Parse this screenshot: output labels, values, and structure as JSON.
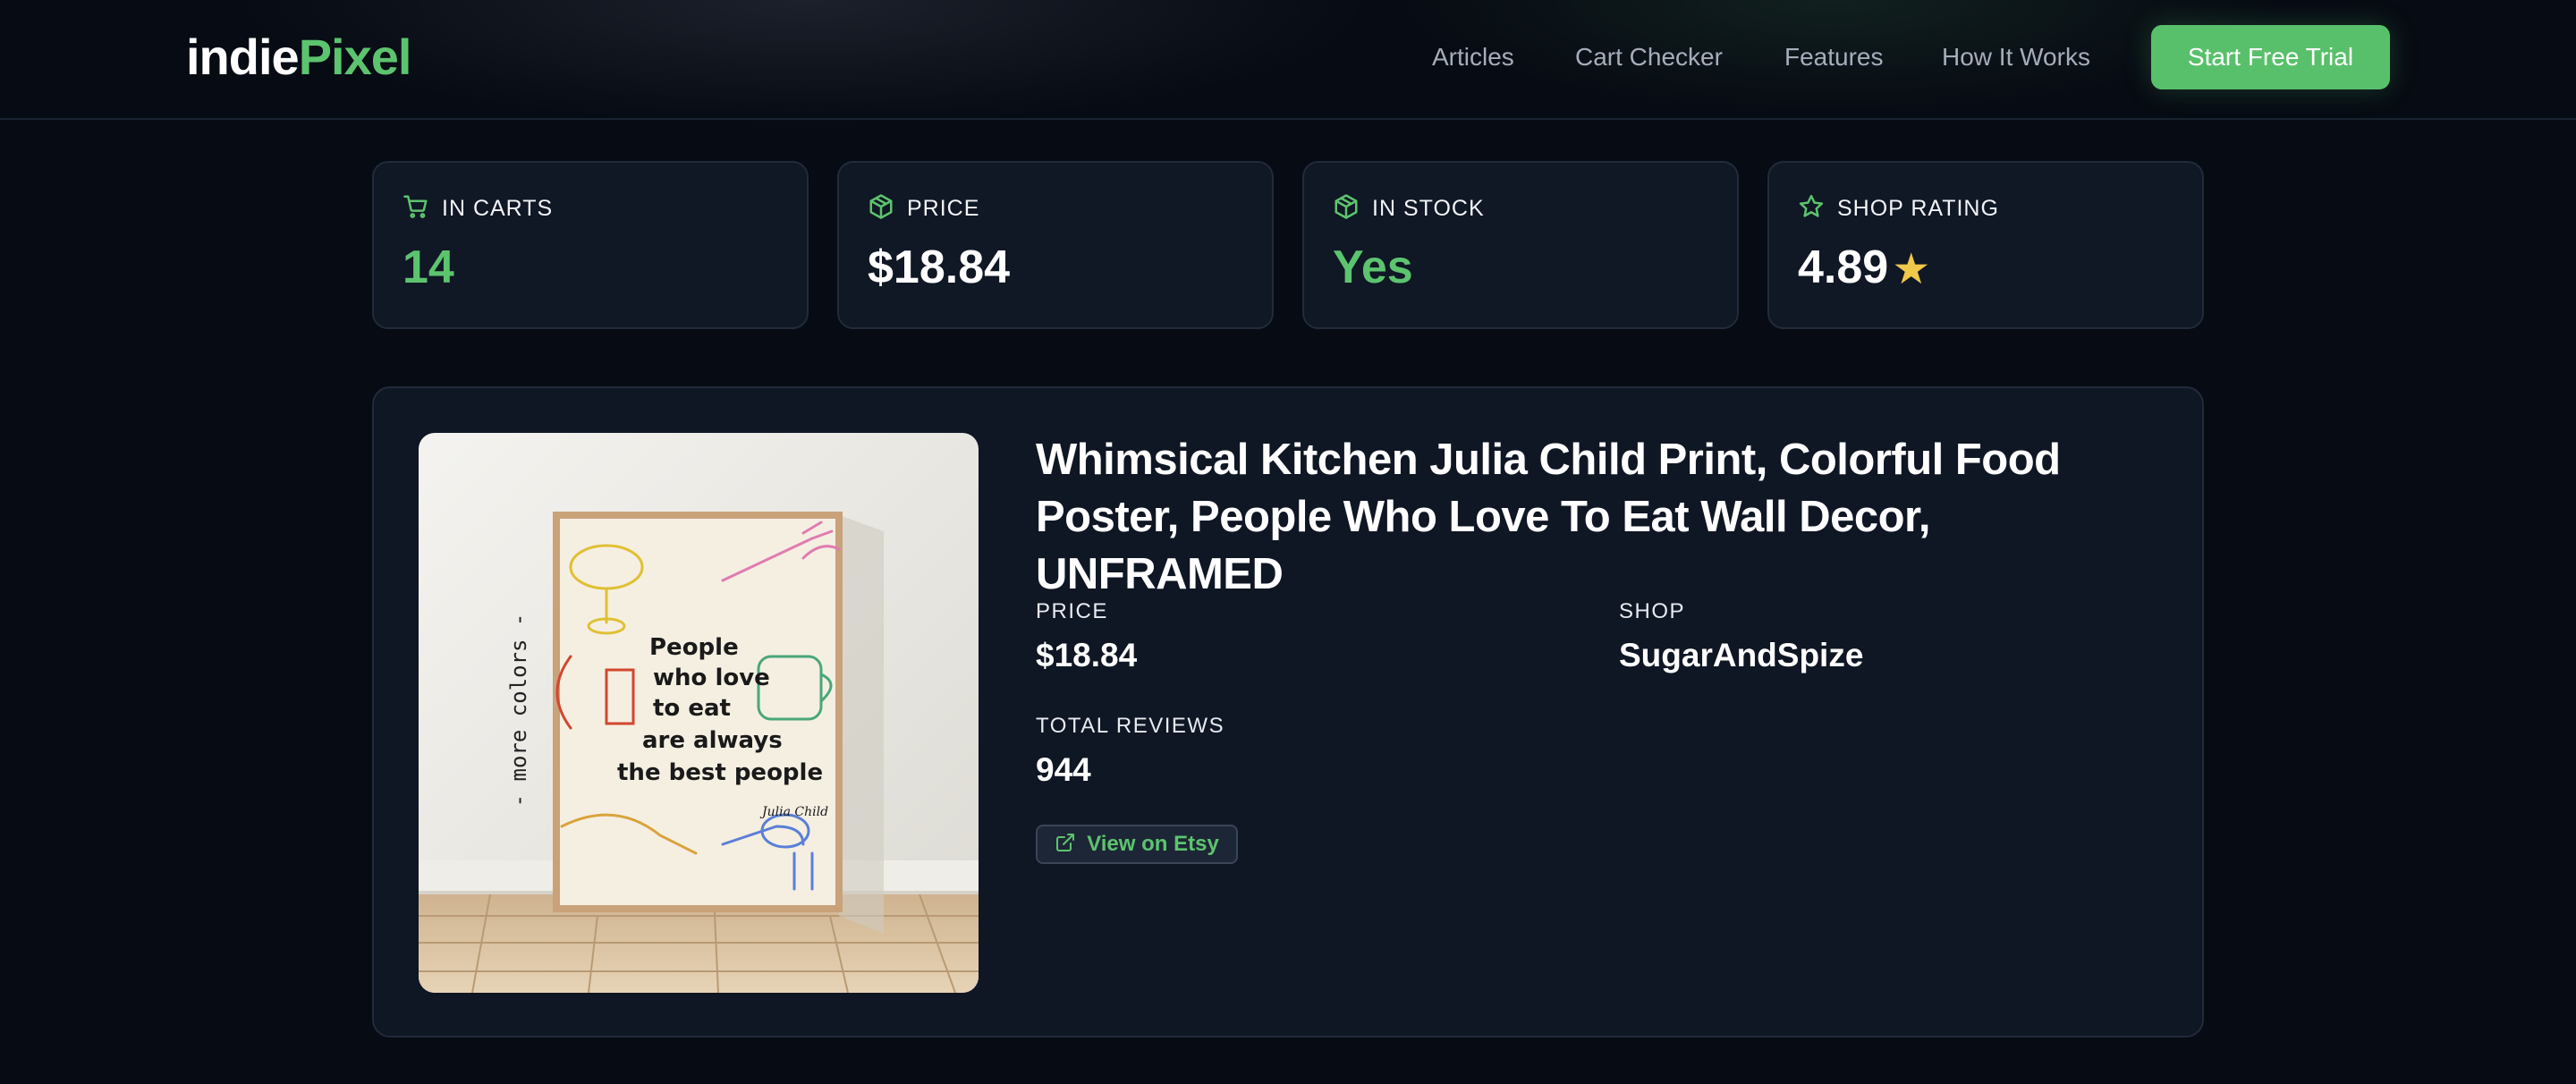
{
  "nav": {
    "logo_part1": "indie",
    "logo_part2": "Pixel",
    "links": [
      "Articles",
      "Cart Checker",
      "Features",
      "How It Works"
    ],
    "cta_label": "Start Free Trial"
  },
  "stats": [
    {
      "label": "IN CARTS",
      "value": "14",
      "icon": "cart-icon"
    },
    {
      "label": "PRICE",
      "value": "$18.84",
      "icon": "box-icon"
    },
    {
      "label": "IN STOCK",
      "value": "Yes",
      "icon": "box-icon"
    },
    {
      "label": "SHOP RATING",
      "value": "4.89",
      "icon": "star-icon",
      "star_glyph": "★"
    }
  ],
  "product": {
    "title": "Whimsical Kitchen Julia Child Print, Colorful Food Poster, People Who Love To Eat Wall Decor, UNFRAMED",
    "price_label": "PRICE",
    "price_value": "$18.84",
    "shop_label": "SHOP",
    "shop_value": "SugarAndSpize",
    "reviews_label": "TOTAL REVIEWS",
    "reviews_value": "944",
    "etsy_label": "View on Etsy",
    "image": {
      "side_text": "- more colors -",
      "poster_lines": [
        "People",
        "who love",
        "to eat",
        "are always",
        "the best people"
      ],
      "signature": "Julia Child"
    }
  },
  "colors": {
    "accent": "#5cc46e",
    "background": "#070b13",
    "card": "#101725",
    "star": "#f0c94a"
  }
}
